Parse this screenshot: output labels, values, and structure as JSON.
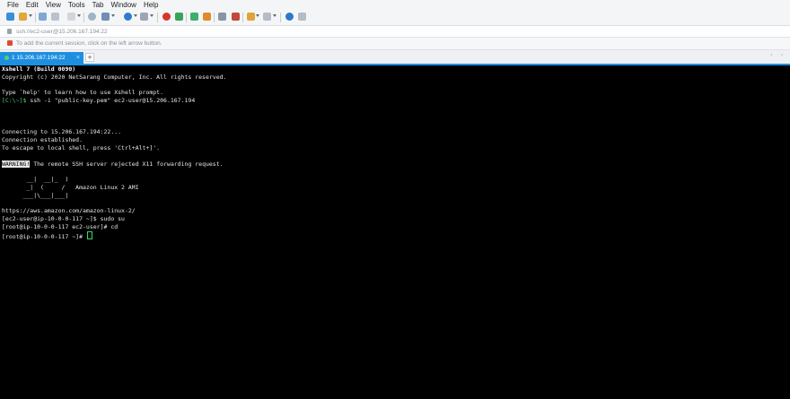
{
  "menu": [
    "File",
    "Edit",
    "View",
    "Tools",
    "Tab",
    "Window",
    "Help"
  ],
  "address": {
    "text": "ssh://ec2-user@15.206.167.194:22"
  },
  "hint": {
    "text": "To add the current session, click on the left arrow button."
  },
  "tab": {
    "label": "1 15.206.167.194:22",
    "close": "×",
    "add": "+",
    "nav": "‹ ›"
  },
  "terminal": {
    "header_title": "Xshell 7 (Build 0090)",
    "copyright": "Copyright (c) 2020 NetSarang Computer, Inc. All rights reserved.",
    "help_line": "Type `help' to learn how to use Xshell prompt.",
    "local_prompt": "[C:\\~]$",
    "local_cmd": " ssh -i \"public-key.pem\" ec2-user@15.206.167.194",
    "connecting": "Connecting to 15.206.167.194:22...",
    "established": "Connection established.",
    "escape": "To escape to local shell, press 'Ctrl+Alt+]'.",
    "warning_tag": "WARNING!",
    "warning_msg": " The remote SSH server rejected X11 forwarding request.",
    "ascii_1": "       __|  __|_  )",
    "ascii_2": "       _|  (     /   Amazon Linux 2 AMI",
    "ascii_3": "      ___|\\___|___|",
    "url": "https://aws.amazon.com/amazon-linux-2/",
    "line_sudo": "[ec2-user@ip-10-0-0-117 ~]$ sudo su",
    "line_cd": "[root@ip-10-0-0-117 ec2-user]# cd",
    "line_prompt": "[root@ip-10-0-0-117 ~]# "
  }
}
